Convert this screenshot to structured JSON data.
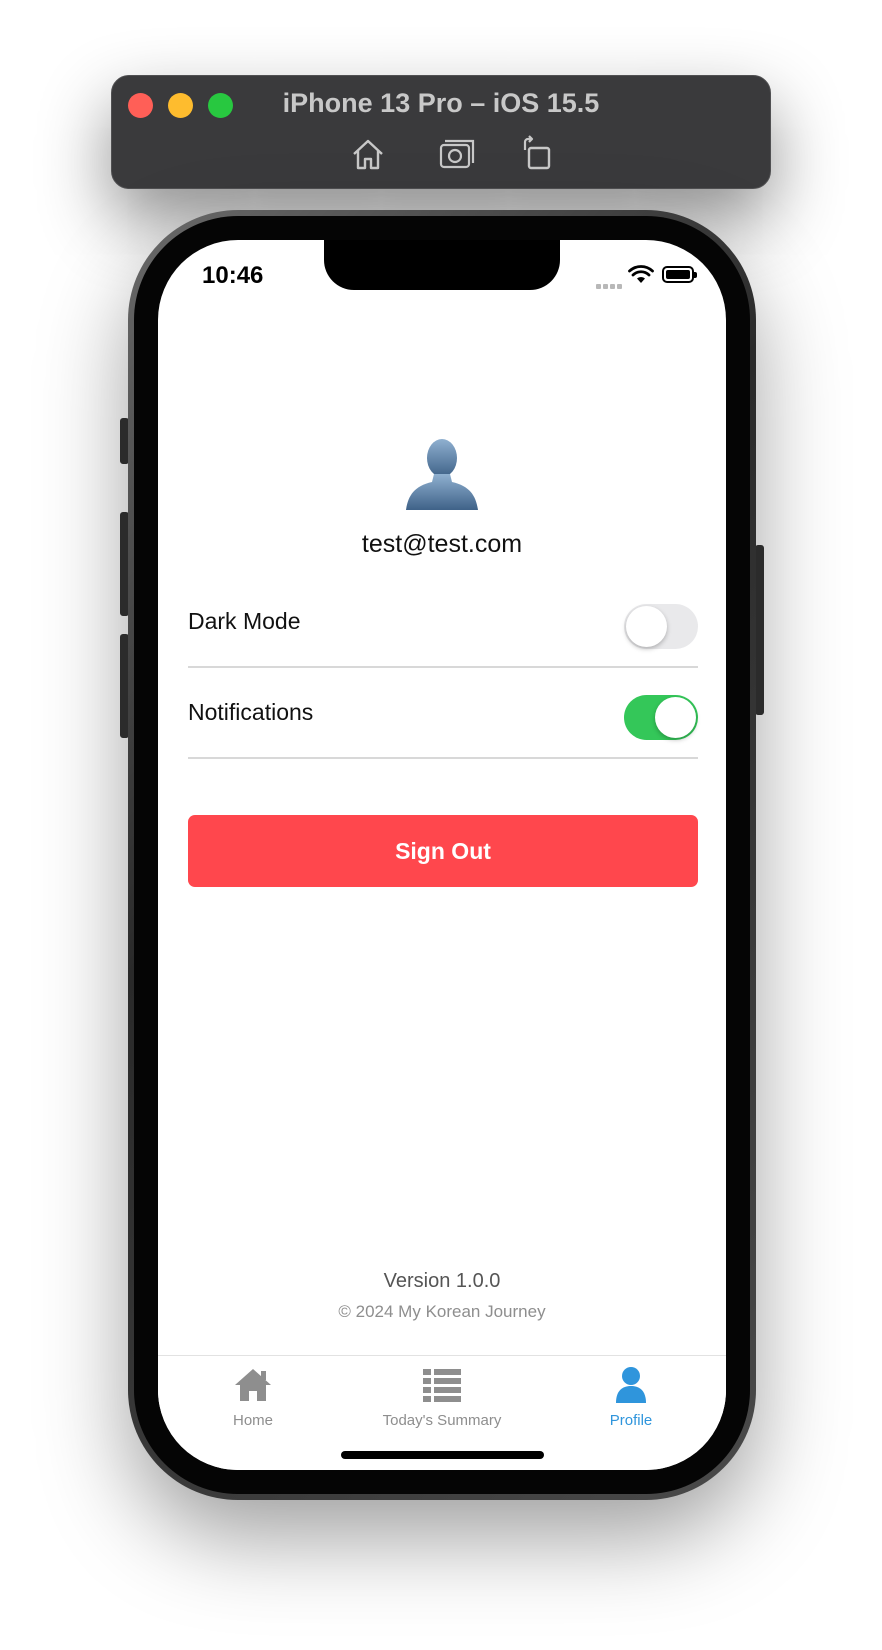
{
  "simulator": {
    "title": "iPhone 13 Pro – iOS 15.5",
    "toolbar_icons": [
      "home-icon",
      "screenshot-icon",
      "rotate-icon"
    ]
  },
  "status_bar": {
    "time": "10:46",
    "icons": [
      "signal-icon",
      "wifi-icon",
      "battery-icon"
    ]
  },
  "profile": {
    "avatar_icon": "user-silhouette-icon",
    "email": "test@test.com"
  },
  "settings": [
    {
      "label": "Dark Mode",
      "enabled": false
    },
    {
      "label": "Notifications",
      "enabled": true
    }
  ],
  "sign_out_label": "Sign Out",
  "footer": {
    "version": "Version 1.0.0",
    "copyright": "© 2024 My Korean Journey"
  },
  "tabs": [
    {
      "label": "Home",
      "icon": "home-icon",
      "active": false
    },
    {
      "label": "Today's Summary",
      "icon": "list-icon",
      "active": false
    },
    {
      "label": "Profile",
      "icon": "user-icon",
      "active": true
    }
  ],
  "colors": {
    "accent": "#2f95dc",
    "toggle_on": "#34c759",
    "sign_out": "#ff474d"
  }
}
